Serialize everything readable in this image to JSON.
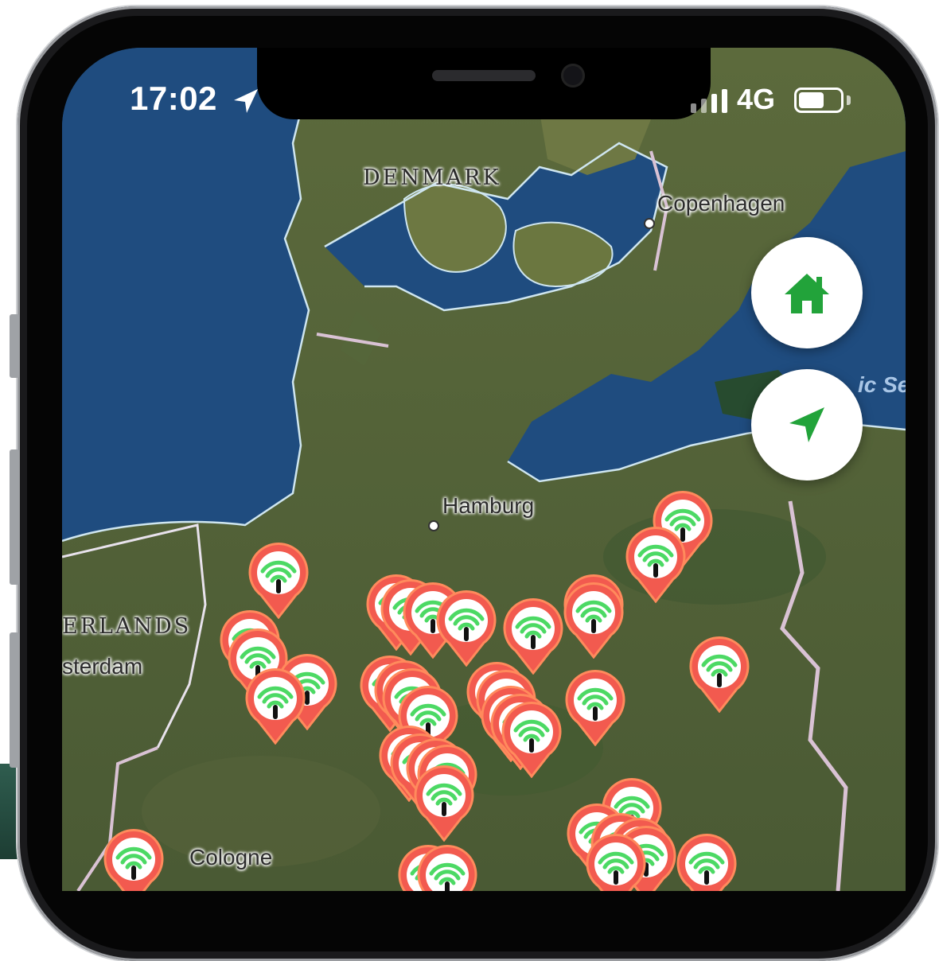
{
  "status_bar": {
    "time": "17:02",
    "network": "4G"
  },
  "map": {
    "labels": {
      "denmark": "DENMARK",
      "copenhagen": "Copenhagen",
      "hamburg": "Hamburg",
      "netherlands": "ERLANDS",
      "amsterdam": "sterdam",
      "cologne": "Cologne",
      "baltic_sea": "ic Se"
    }
  },
  "controls": {
    "home_icon": "home-icon",
    "locate_icon": "navigation-arrow-icon",
    "accent_color": "#22a33a"
  },
  "markers": {
    "icon": "wifi-signal-icon",
    "color": "#f25a4f",
    "count": 40
  }
}
